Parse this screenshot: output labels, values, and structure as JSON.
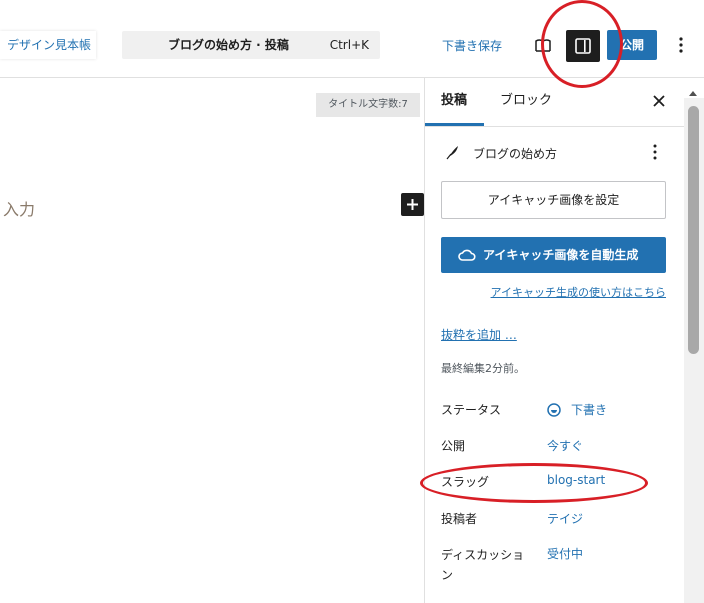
{
  "header": {
    "design_link": "デザイン見本帳",
    "command_title": "ブログの始め方 · 投稿",
    "command_shortcut": "Ctrl+K",
    "save_draft": "下書き保存",
    "publish": "公開",
    "preview_icon": "book-icon",
    "sidebar_toggle_icon": "sidebar-panel-icon",
    "options_icon": "vertical-ellipsis-icon"
  },
  "editor": {
    "title_counter": "タイトル文字数:7",
    "placeholder_fragment": "入力",
    "add_block_icon": "plus-icon"
  },
  "sidebar": {
    "tabs": [
      {
        "label": "投稿",
        "active": true
      },
      {
        "label": "ブロック",
        "active": false
      }
    ],
    "close_icon": "close-icon",
    "post_title": "ブログの始め方",
    "post_icon": "feather-icon",
    "featured_image_button": "アイキャッチ画像を設定",
    "autogen_button": "アイキャッチ画像を自動生成",
    "autogen_icon": "cloud-icon",
    "autogen_howto_link": "アイキャッチ生成の使い方はこちら",
    "add_excerpt_link": "抜粋を追加 …",
    "last_edited": "最終編集2分前。",
    "rows": [
      {
        "label": "ステータス",
        "value": "下書き"
      },
      {
        "label": "公開",
        "value": "今すぐ"
      },
      {
        "label": "スラッグ",
        "value": "blog-start"
      },
      {
        "label": "投稿者",
        "value": "テイジ"
      },
      {
        "label": "ディスカッション",
        "value": "受付中"
      }
    ],
    "status_icon": "draft-status-icon"
  },
  "colors": {
    "accent": "#2271b1",
    "dark": "#1e1e1e",
    "annotation": "#d81f26"
  }
}
